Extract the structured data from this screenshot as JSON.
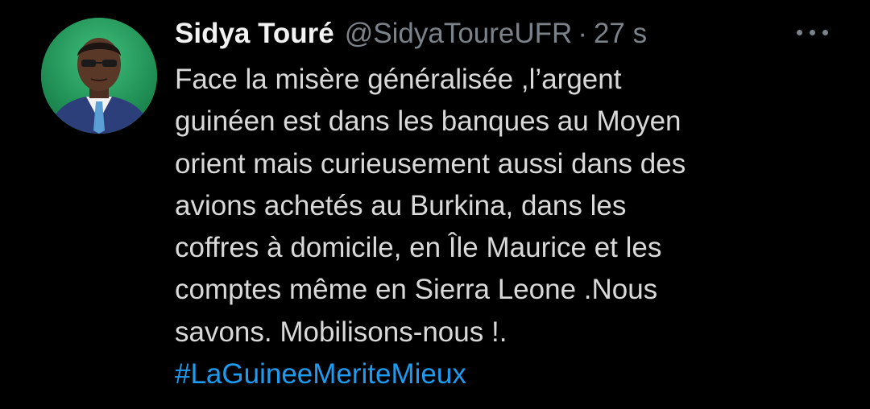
{
  "tweet": {
    "author_name": "Sidya Touré",
    "handle": "@SidyaToureUFR",
    "separator": "·",
    "timestamp": "27 s",
    "lines": [
      "Face la misère généralisée ,l’argent",
      "guinéen est dans les banques au Moyen",
      "orient mais curieusement aussi dans des",
      "avions achetés au Burkina, dans les",
      "coffres à domicile, en Île Maurice et les",
      "comptes même en Sierra Leone .Nous",
      "savons. Mobilisons-nous !."
    ],
    "hashtag": "#LaGuineeMeriteMieux"
  },
  "icons": {
    "more": "more-horizontal-icon",
    "avatar": "profile-avatar"
  },
  "colors": {
    "background": "#000000",
    "name": "#f2f2f2",
    "muted": "#7b8289",
    "body_text": "#d9d9d9",
    "hashtag": "#1d9bf0"
  }
}
